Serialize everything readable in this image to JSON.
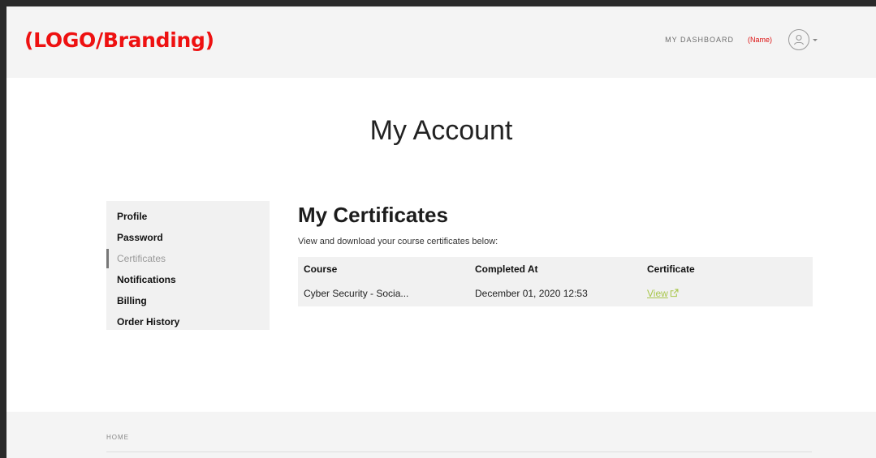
{
  "header": {
    "logo": "(LOGO/Branding)",
    "nav_dashboard": "MY DASHBOARD",
    "user_name": "(Name)"
  },
  "page": {
    "title": "My Account"
  },
  "sidebar": {
    "items": [
      {
        "label": "Profile",
        "active": false
      },
      {
        "label": "Password",
        "active": false
      },
      {
        "label": "Certificates",
        "active": true
      },
      {
        "label": "Notifications",
        "active": false
      },
      {
        "label": "Billing",
        "active": false
      },
      {
        "label": "Order History",
        "active": false
      }
    ]
  },
  "certificates": {
    "heading": "My Certificates",
    "description": "View and download your course certificates below:",
    "columns": [
      "Course",
      "Completed At",
      "Certificate"
    ],
    "rows": [
      {
        "course": "Cyber Security - Socia...",
        "completed_at": "December 01, 2020 12:53",
        "certificate_link": "View"
      }
    ]
  },
  "footer": {
    "home": "HOME"
  },
  "colors": {
    "logo": "#ee1111",
    "user_name": "#dd1111",
    "link": "#a8c64a",
    "panel_bg": "#f1f1f1"
  },
  "icons": {
    "avatar": "user-avatar-icon",
    "dropdown": "caret-down-icon",
    "external_link": "external-link-icon"
  }
}
